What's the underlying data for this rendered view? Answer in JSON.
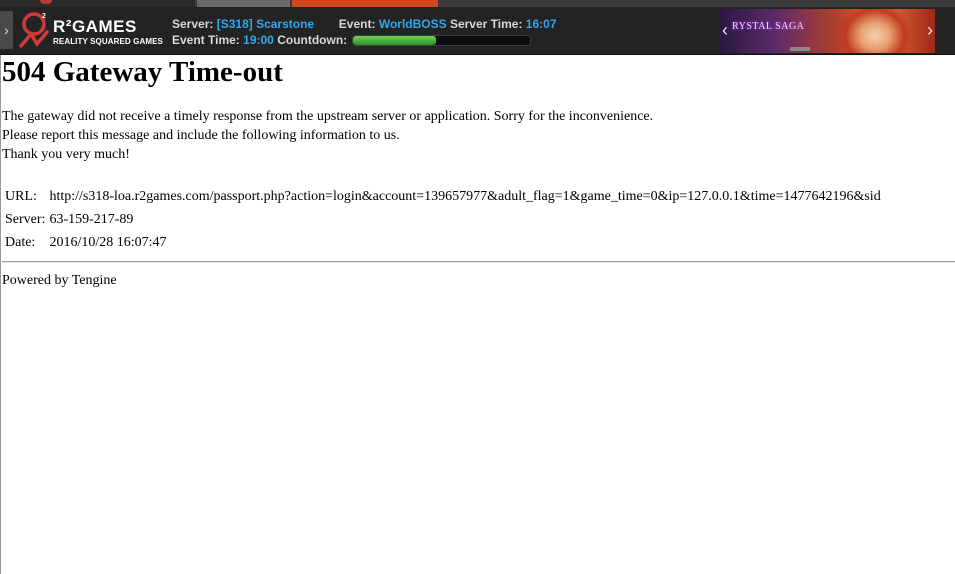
{
  "toolbar": {
    "brand_name": "R²GAMES",
    "brand_tagline": "REALITY SQUARED GAMES",
    "server_label": "Server:",
    "server_value": "[S318] Scarstone",
    "event_label": "Event:",
    "event_value": "WorldBOSS",
    "server_time_label": "Server Time:",
    "server_time_value": "16:07",
    "event_time_label": "Event Time:",
    "event_time_value": "19:00",
    "countdown_label": "Countdown:",
    "countdown_progress": 0.47,
    "banner_title": "RYSTAL SAGA",
    "accent_color": "#2ea8f2",
    "progress_color": "#3aa72c"
  },
  "page": {
    "heading": "504 Gateway Time-out",
    "message_1": "The gateway did not receive a timely response from the upstream server or application. Sorry for the inconvenience.",
    "message_2": "Please report this message and include the following information to us.",
    "message_3": "Thank you very much!",
    "details": [
      {
        "label": "URL:",
        "value": "http://s318-loa.r2games.com/passport.php?action=login&account=139657977&adult_flag=1&game_time=0&ip=127.0.0.1&time=1477642196&sid"
      },
      {
        "label": "Server:",
        "value": "63-159-217-89"
      },
      {
        "label": "Date:",
        "value": "2016/10/28 16:07:47"
      }
    ],
    "footer": "Powered by Tengine"
  }
}
